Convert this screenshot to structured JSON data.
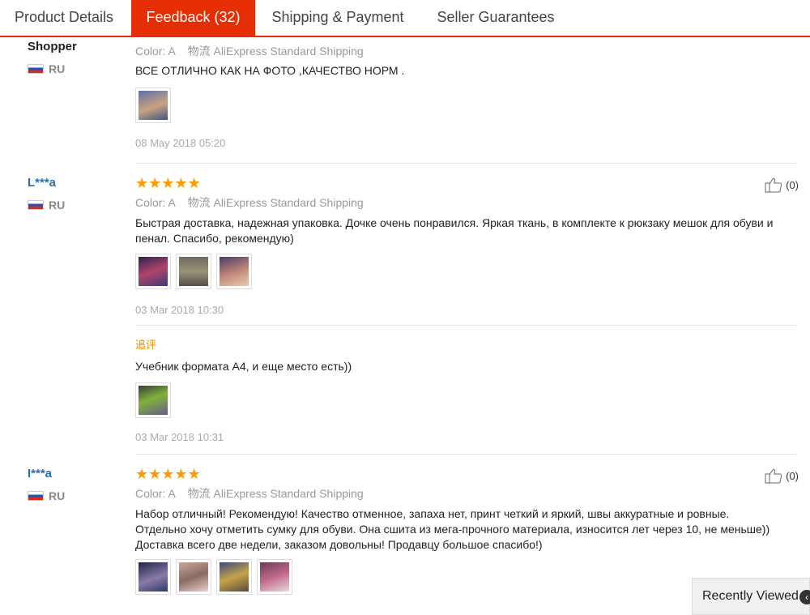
{
  "tabs": [
    {
      "label": "Product Details"
    },
    {
      "label": "Feedback (32)"
    },
    {
      "label": "Shipping & Payment"
    },
    {
      "label": "Seller Guarantees"
    }
  ],
  "reviews": [
    {
      "user": "Shopper",
      "country": "RU",
      "color": "Color: A",
      "logistics_label": "物流",
      "shipping": "AliExpress Standard Shipping",
      "text": "ВСЕ ОТЛИЧНО КАК НА ФОТО ,КАЧЕСТВО НОРМ .",
      "date": "08 May 2018 05:20"
    },
    {
      "user": "L***a",
      "country": "RU",
      "stars": "★★★★★",
      "rating": 5,
      "color": "Color: A",
      "logistics_label": "物流",
      "shipping": "AliExpress Standard Shipping",
      "text_line1": "Быстрая доставка, надежная упаковка. Дочке очень понравился. Яркая ткань, в комплекте к рюкзаку мешок для обуви и",
      "text_line2": "пенал. Спасибо, рекомендую)",
      "date": "03 Mar 2018 10:30",
      "helpful": "(0)",
      "additional": {
        "label": "追评",
        "text": "Учебник формата А4, и еще место есть))",
        "date": "03 Mar 2018 10:31"
      }
    },
    {
      "user": "I***a",
      "country": "RU",
      "stars": "★★★★★",
      "rating": 5,
      "color": "Color: A",
      "logistics_label": "物流",
      "shipping": "AliExpress Standard Shipping",
      "text_line1": "Набор отличный! Рекомендую! Качество отменное, запаха нет, принт четкий и яркий, швы аккуратные и ровные.",
      "text_line2": "Отдельно хочу отметить сумку для обуви. Она сшита из мега-прочного материала, износится лет через 10, не меньше))",
      "text_line3": "Доставка всего две недели, заказом довольны! Продавцу большое спасибо!)",
      "helpful": "(0)"
    }
  ],
  "recently_viewed": "Recently Viewed"
}
